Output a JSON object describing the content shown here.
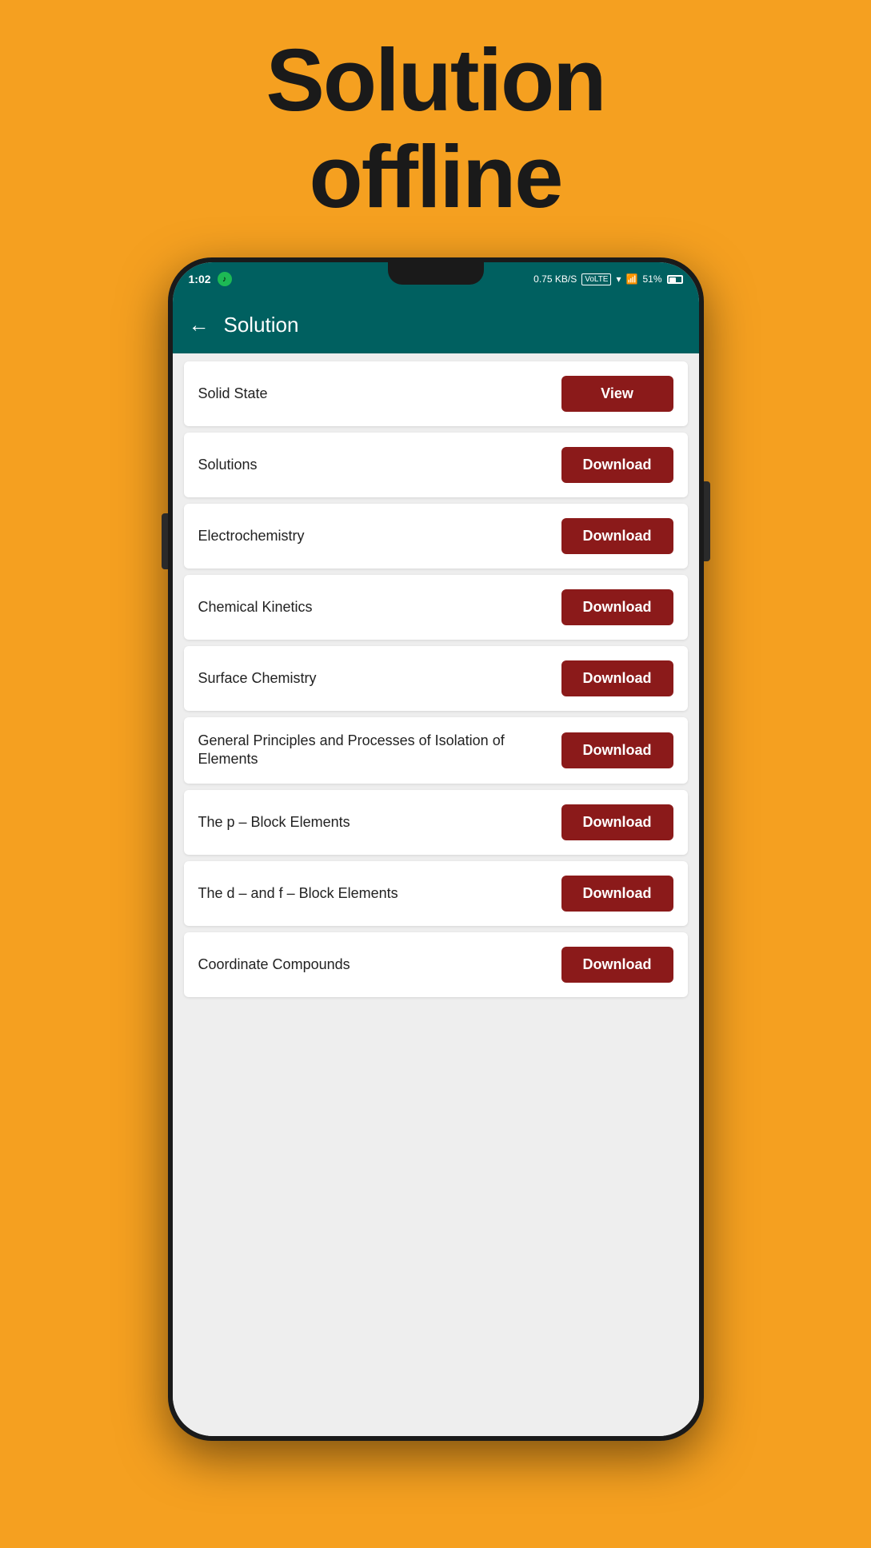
{
  "hero": {
    "line1": "Solution",
    "line2": "offline"
  },
  "statusBar": {
    "time": "1:02",
    "network": "0.75 KB/S",
    "volte": "VoLTE",
    "battery": "51%"
  },
  "appBar": {
    "title": "Solution",
    "backLabel": "←"
  },
  "items": [
    {
      "id": 1,
      "title": "Solid State",
      "buttonLabel": "View",
      "buttonType": "view"
    },
    {
      "id": 2,
      "title": "Solutions",
      "buttonLabel": "Download",
      "buttonType": "download"
    },
    {
      "id": 3,
      "title": "Electrochemistry",
      "buttonLabel": "Download",
      "buttonType": "download"
    },
    {
      "id": 4,
      "title": "Chemical Kinetics",
      "buttonLabel": "Download",
      "buttonType": "download"
    },
    {
      "id": 5,
      "title": "Surface Chemistry",
      "buttonLabel": "Download",
      "buttonType": "download"
    },
    {
      "id": 6,
      "title": "General Principles and Processes of Isolation of Elements",
      "buttonLabel": "Download",
      "buttonType": "download"
    },
    {
      "id": 7,
      "title": "The p – Block Elements",
      "buttonLabel": "Download",
      "buttonType": "download"
    },
    {
      "id": 8,
      "title": "The d – and f – Block Elements",
      "buttonLabel": "Download",
      "buttonType": "download"
    },
    {
      "id": 9,
      "title": "Coordinate Compounds",
      "buttonLabel": "Download",
      "buttonType": "download"
    }
  ]
}
